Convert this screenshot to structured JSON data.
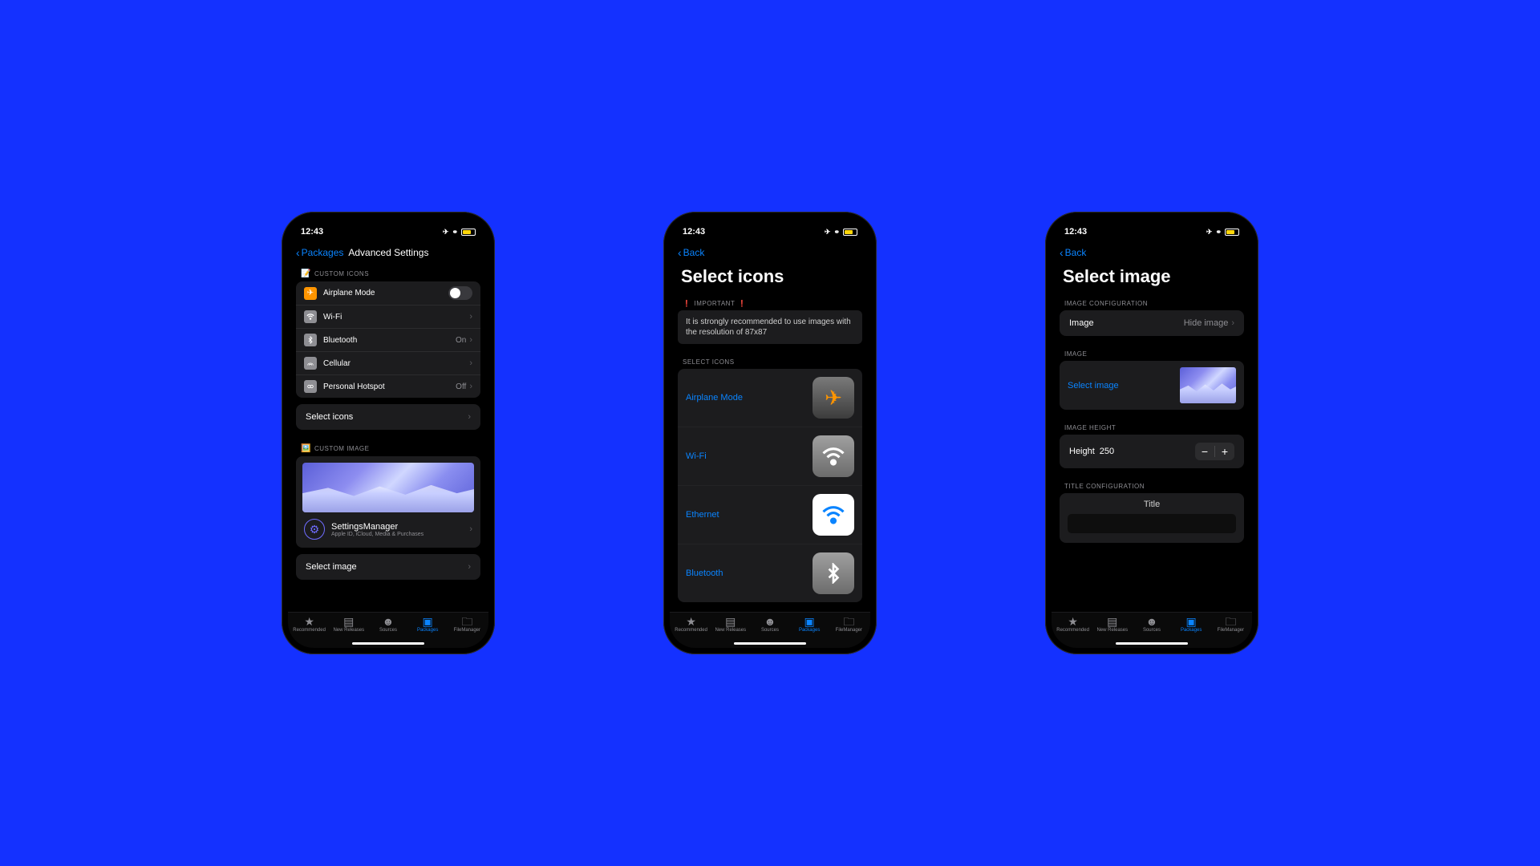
{
  "status": {
    "time": "12:43"
  },
  "screen1": {
    "back": "Packages",
    "title": "Advanced Settings",
    "sections": {
      "icons_header": "CUSTOM ICONS",
      "rows": {
        "airplane": "Airplane Mode",
        "wifi": "Wi-Fi",
        "bluetooth": "Bluetooth",
        "bluetooth_val": "On",
        "cellular": "Cellular",
        "hotspot": "Personal Hotspot",
        "hotspot_val": "Off"
      },
      "select_icons": "Select icons",
      "image_header": "CUSTOM IMAGE",
      "sm_title": "SettingsManager",
      "sm_sub": "Apple ID, iCloud, Media & Purchases",
      "select_image": "Select image"
    }
  },
  "screen2": {
    "back": "Back",
    "title": "Select icons",
    "important_label": "IMPORTANT",
    "important_text": "It is strongly recommended to use images with the resolution of 87x87",
    "sel_header": "SELECT ICONS",
    "rows": {
      "airplane": "Airplane Mode",
      "wifi": "Wi-Fi",
      "ethernet": "Ethernet",
      "bluetooth": "Bluetooth"
    }
  },
  "screen3": {
    "back": "Back",
    "title": "Select image",
    "img_config_header": "IMAGE CONFIGURATION",
    "image_label": "Image",
    "image_value": "Hide image",
    "image_header": "IMAGE",
    "select_image": "Select image",
    "height_header": "IMAGE HEIGHT",
    "height_label": "Height",
    "height_value": "250",
    "title_config_header": "TITLE CONFIGURATION",
    "title_label": "Title"
  },
  "tabs": {
    "rec": "Recommended",
    "new": "New Releases",
    "src": "Sources",
    "pkg": "Packages",
    "fm": "FileManager"
  }
}
